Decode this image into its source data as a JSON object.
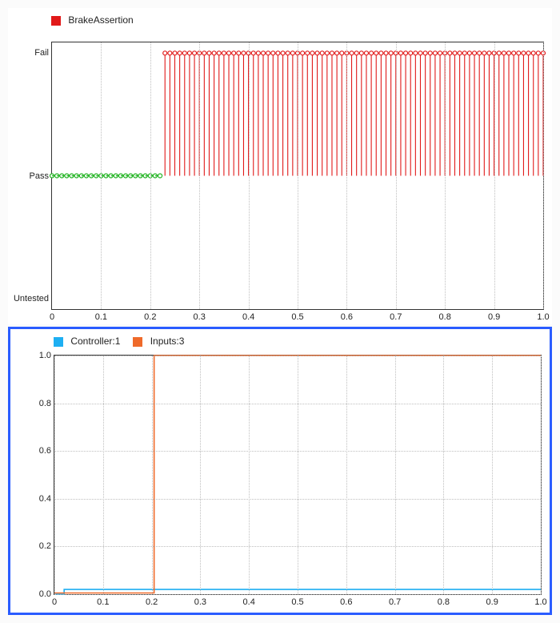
{
  "top": {
    "legend": {
      "label": "BrakeAssertion",
      "color": "#e11919"
    },
    "y_categories": [
      "Fail",
      "Pass",
      "Untested"
    ],
    "x_ticks": [
      "0",
      "0.1",
      "0.2",
      "0.3",
      "0.4",
      "0.5",
      "0.6",
      "0.7",
      "0.8",
      "0.9",
      "1.0"
    ],
    "colors": {
      "pass": "#24b424",
      "fail": "#e11919"
    }
  },
  "bot": {
    "legend": [
      {
        "label": "Controller:1",
        "color": "#1eaff2"
      },
      {
        "label": "Inputs:3",
        "color": "#ef6a2a"
      }
    ],
    "y_ticks": [
      "0.0",
      "0.2",
      "0.4",
      "0.6",
      "0.8",
      "1.0"
    ],
    "x_ticks": [
      "0",
      "0.1",
      "0.2",
      "0.3",
      "0.4",
      "0.5",
      "0.6",
      "0.7",
      "0.8",
      "0.9",
      "1.0"
    ]
  },
  "chart_data": [
    {
      "type": "line",
      "title": "",
      "xlabel": "",
      "ylabel": "",
      "xlim": [
        0,
        1.0
      ],
      "y_categories": [
        "Untested",
        "Pass",
        "Fail"
      ],
      "series": [
        {
          "name": "BrakeAssertion",
          "pass_until_x": 0.22,
          "sample_dx": 0.01,
          "pass_level": "Pass",
          "fail_high": "Fail",
          "fail_low": "Pass"
        }
      ],
      "note": "0..0.22 constant at Pass (green circles); 0.23..1.0 vertical impulses Pass↔Fail each 0.01 (red open circles at Fail)"
    },
    {
      "type": "line",
      "title": "",
      "xlabel": "",
      "ylabel": "",
      "xlim": [
        0,
        1.0
      ],
      "ylim": [
        0,
        1.0
      ],
      "grid": true,
      "series": [
        {
          "name": "Controller:1",
          "color": "#1eaff2",
          "points": [
            [
              0,
              0
            ],
            [
              0.02,
              0
            ],
            [
              0.02,
              0.02
            ],
            [
              1.0,
              0.02
            ]
          ]
        },
        {
          "name": "Inputs:3",
          "color": "#ef6a2a",
          "points": [
            [
              0,
              0.005
            ],
            [
              0.205,
              0.005
            ],
            [
              0.205,
              1.0
            ],
            [
              1.0,
              1.0
            ]
          ]
        }
      ]
    }
  ]
}
